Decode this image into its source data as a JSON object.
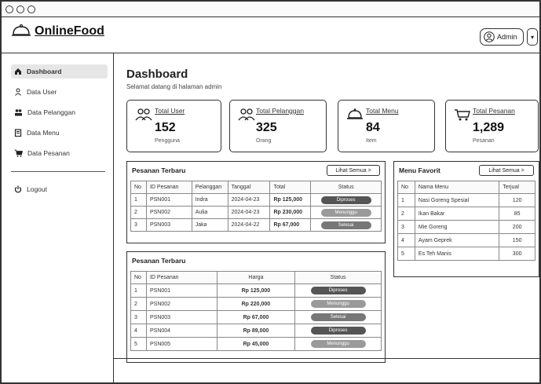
{
  "brand": {
    "name": "OnlineFood"
  },
  "header": {
    "user_label": "Admin"
  },
  "sidebar": {
    "items": [
      {
        "label": "Dashboard",
        "icon": "home-icon"
      },
      {
        "label": "Data User",
        "icon": "user-icon"
      },
      {
        "label": "Data Pelanggan",
        "icon": "users-icon"
      },
      {
        "label": "Data Menu",
        "icon": "book-icon"
      },
      {
        "label": "Data Pesanan",
        "icon": "cart-icon"
      }
    ],
    "logout": "Logout"
  },
  "page": {
    "title": "Dashboard",
    "subtitle": "Selamat datang di halaman admin"
  },
  "cards": [
    {
      "label": "Total User",
      "value": "152",
      "unit": "Pengguna",
      "icon": "users-icon"
    },
    {
      "label": "Total Pelanggan",
      "value": "325",
      "unit": "Orang",
      "icon": "users-icon"
    },
    {
      "label": "Total Menu",
      "value": "84",
      "unit": "Item",
      "icon": "cloche-icon"
    },
    {
      "label": "Total Pesanan",
      "value": "1,289",
      "unit": "Pesanan",
      "icon": "cart-icon"
    }
  ],
  "orders_recent": {
    "title": "Pesanan Terbaru",
    "button": "Lihat Semua >",
    "headers": [
      "No",
      "ID Pesanan",
      "Pelanggan",
      "Tanggal",
      "Total",
      "Status"
    ],
    "rows": [
      {
        "no": "1",
        "id": "PSN001",
        "customer": "Indra",
        "date": "2024-04-23",
        "total": "Rp 125,000",
        "status": "Diproses"
      },
      {
        "no": "2",
        "id": "PSN002",
        "customer": "Aulia",
        "date": "2024-04-23",
        "total": "Rp 230,000",
        "status": "Menunggu"
      },
      {
        "no": "3",
        "id": "PSN003",
        "customer": "Jaka",
        "date": "2024-04-22",
        "total": "Rp 67,000",
        "status": "Selesai"
      }
    ]
  },
  "menu_favorite": {
    "title": "Menu Favorit",
    "button": "Lihat Semua >",
    "headers": [
      "No",
      "Nama Menu",
      "Terjual"
    ],
    "rows": [
      {
        "no": "1",
        "name": "Nasi Goreng Spesial",
        "sold": "120"
      },
      {
        "no": "2",
        "name": "Ikan Bakar",
        "sold": "85"
      },
      {
        "no": "3",
        "name": "Mie Goreng",
        "sold": "200"
      },
      {
        "no": "4",
        "name": "Ayam Geprek",
        "sold": "150"
      },
      {
        "no": "5",
        "name": "Es Teh Manis",
        "sold": "300"
      }
    ]
  },
  "orders_second": {
    "title": "Pesanan Terbaru",
    "headers": [
      "No",
      "ID Pesanan",
      "Harga",
      "Status"
    ],
    "rows": [
      {
        "no": "1",
        "id": "PSN001",
        "price": "Rp 125,000",
        "status": "Diproses"
      },
      {
        "no": "2",
        "id": "PSN002",
        "price": "Rp 220,000",
        "status": "Menunggu"
      },
      {
        "no": "3",
        "id": "PSN003",
        "price": "Rp 67,000",
        "status": "Selesai"
      },
      {
        "no": "4",
        "id": "PSN004",
        "price": "Rp 89,000",
        "status": "Diproses"
      },
      {
        "no": "5",
        "id": "PSN005",
        "price": "Rp 45,000",
        "status": "Menunggu"
      }
    ]
  },
  "status_colors": {
    "Diproses": "#555555",
    "Menunggu": "#9a9a9a",
    "Selesai": "#777777"
  }
}
